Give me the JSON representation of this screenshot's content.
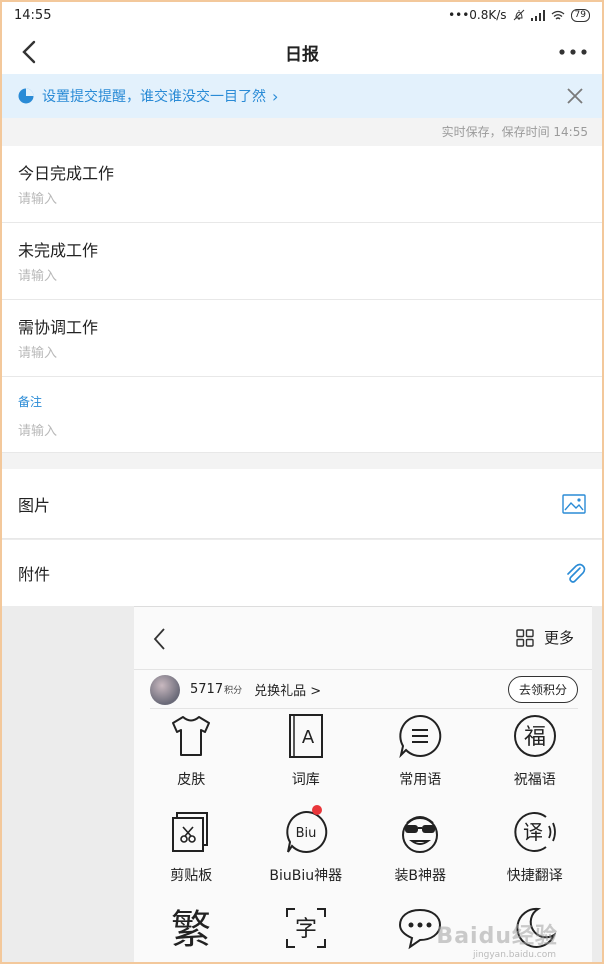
{
  "status_bar": {
    "time": "14:55",
    "net_speed": "•••0.8K/s",
    "battery": "79"
  },
  "nav": {
    "title": "日报"
  },
  "banner": {
    "text": "设置提交提醒，谁交谁没交一目了然",
    "chevron": "›"
  },
  "autosave": "实时保存，保存时间 14:55",
  "fields": [
    {
      "label": "今日完成工作",
      "placeholder": "请输入"
    },
    {
      "label": "未完成工作",
      "placeholder": "请输入"
    },
    {
      "label": "需协调工作",
      "placeholder": "请输入"
    },
    {
      "label": "备注",
      "placeholder": "请输入"
    }
  ],
  "rows": {
    "image_label": "图片",
    "attachment_label": "附件"
  },
  "keyboard": {
    "more_label": "更多",
    "points_value": "5717",
    "points_unit": "积分",
    "redeem_label": "兑换礼品 >",
    "earn_button": "去领积分",
    "tiles": [
      {
        "label": "皮肤",
        "icon": "tshirt-icon"
      },
      {
        "label": "词库",
        "icon": "dictionary-icon"
      },
      {
        "label": "常用语",
        "icon": "phrases-icon"
      },
      {
        "label": "祝福语",
        "icon": "blessing-icon"
      },
      {
        "label": "剪贴板",
        "icon": "clipboard-icon"
      },
      {
        "label": "BiuBiu神器",
        "icon": "biu-icon"
      },
      {
        "label": "装B神器",
        "icon": "cool-face-icon"
      },
      {
        "label": "快捷翻译",
        "icon": "translate-icon"
      },
      {
        "label": "",
        "icon": "traditional-chinese-icon"
      },
      {
        "label": "",
        "icon": "text-scan-icon"
      },
      {
        "label": "",
        "icon": "chat-bubble-icon"
      },
      {
        "label": "",
        "icon": "night-mode-icon"
      }
    ],
    "icon_glyphs": {
      "dictionary": "A",
      "blessing": "福",
      "translate": "译",
      "biu": "Biu",
      "traditional": "繁",
      "text_scan": "字"
    }
  },
  "watermark": {
    "text": "Baidu经验",
    "sub": "jingyan.baidu.com"
  },
  "colors": {
    "accent": "#2a8bd6",
    "banner_bg": "#e3f1fc",
    "badge_red": "#e9363a"
  }
}
